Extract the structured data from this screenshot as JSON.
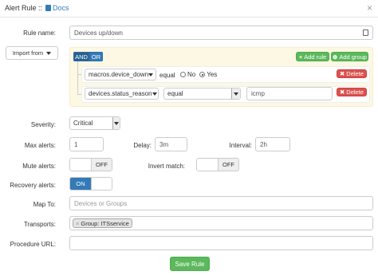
{
  "header": {
    "title": "Alert Rule ::",
    "docs_link": "Docs",
    "close": "×"
  },
  "rule_name": {
    "label": "Rule name:",
    "value": "Devices up/down"
  },
  "import_from": {
    "label": "Import from"
  },
  "query_builder": {
    "and": "AND",
    "or": "OR",
    "add_rule": "Add rule",
    "add_group": "Add group",
    "delete": "Delete",
    "rules": [
      {
        "field": "macros.device_down",
        "operator": "equal",
        "radio_no": "No",
        "radio_yes": "Yes",
        "selected": "Yes"
      },
      {
        "field": "devices.status_reason",
        "operator": "equal",
        "value": "icmp"
      }
    ]
  },
  "severity": {
    "label": "Severity:",
    "value": "Critical"
  },
  "max_alerts": {
    "label": "Max alerts:",
    "value": "1"
  },
  "delay": {
    "label": "Delay:",
    "value": "3m"
  },
  "interval": {
    "label": "Interval:",
    "value": "2h"
  },
  "mute_alerts": {
    "label": "Mute alerts:",
    "state": "OFF"
  },
  "invert_match": {
    "label": "Invert match:",
    "state": "OFF"
  },
  "recovery_alerts": {
    "label": "Recovery alerts:",
    "state": "ON"
  },
  "map_to": {
    "label": "Map To:",
    "placeholder": "Devices or Groups"
  },
  "transports": {
    "label": "Transports:",
    "tag": "Group: ITSservice",
    "tag_remove": "×"
  },
  "procedure_url": {
    "label": "Procedure URL:",
    "value": ""
  },
  "save_button": {
    "label": "Save Rule"
  },
  "colors": {
    "success": "#5cb85c",
    "danger": "#d9534f",
    "primary": "#337ab7",
    "warning_bg": "#fcf8e3"
  }
}
